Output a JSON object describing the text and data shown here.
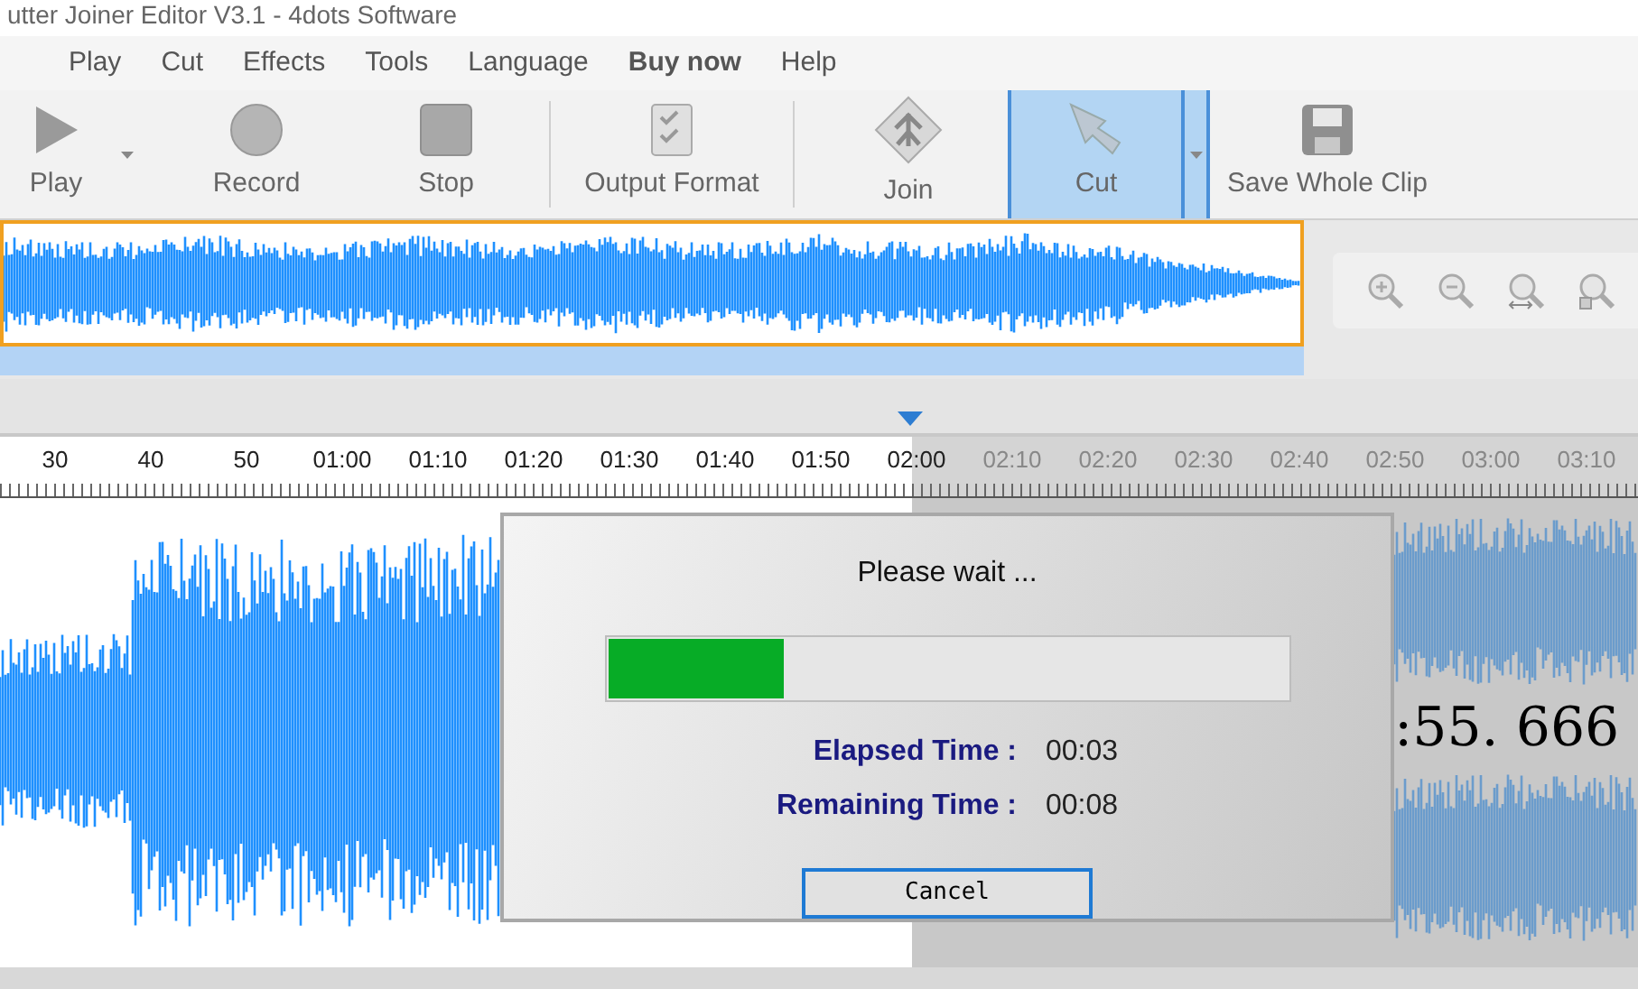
{
  "window": {
    "title": "utter Joiner Editor V3.1 - 4dots Software"
  },
  "menu": [
    {
      "label": "Play",
      "bold": false
    },
    {
      "label": "Cut",
      "bold": false
    },
    {
      "label": "Effects",
      "bold": false
    },
    {
      "label": "Tools",
      "bold": false
    },
    {
      "label": "Language",
      "bold": false
    },
    {
      "label": "Buy now",
      "bold": true
    },
    {
      "label": "Help",
      "bold": false
    }
  ],
  "toolbar": [
    {
      "kind": "play",
      "label": "Play",
      "selected": false,
      "dropdown": true
    },
    {
      "kind": "record",
      "label": "Record",
      "selected": false,
      "dropdown": false
    },
    {
      "kind": "stop",
      "label": "Stop",
      "selected": false,
      "dropdown": false
    },
    {
      "kind": "format",
      "label": "Output Format",
      "selected": false,
      "dropdown": false
    },
    {
      "kind": "join",
      "label": "Join",
      "selected": false,
      "dropdown": false
    },
    {
      "kind": "cut",
      "label": "Cut",
      "selected": true,
      "dropdown": true
    },
    {
      "kind": "save",
      "label": "Save Whole Clip",
      "selected": false,
      "dropdown": false
    }
  ],
  "timeline": {
    "labels": [
      "30",
      "40",
      "50",
      "01:00",
      "01:10",
      "01:20",
      "01:30",
      "01:40",
      "01:50",
      "02:00",
      "02:10",
      "02:20",
      "02:30",
      "02:40",
      "02:50",
      "03:00",
      "03:10"
    ]
  },
  "position_display": ":55. 666",
  "dialog": {
    "title": "Please wait ...",
    "progress": {
      "level": 0.26
    },
    "rows": [
      {
        "label": "Elapsed Time :",
        "value": "00:03"
      },
      {
        "label": "Remaining Time :",
        "value": "00:08"
      }
    ],
    "button": "Cancel"
  }
}
